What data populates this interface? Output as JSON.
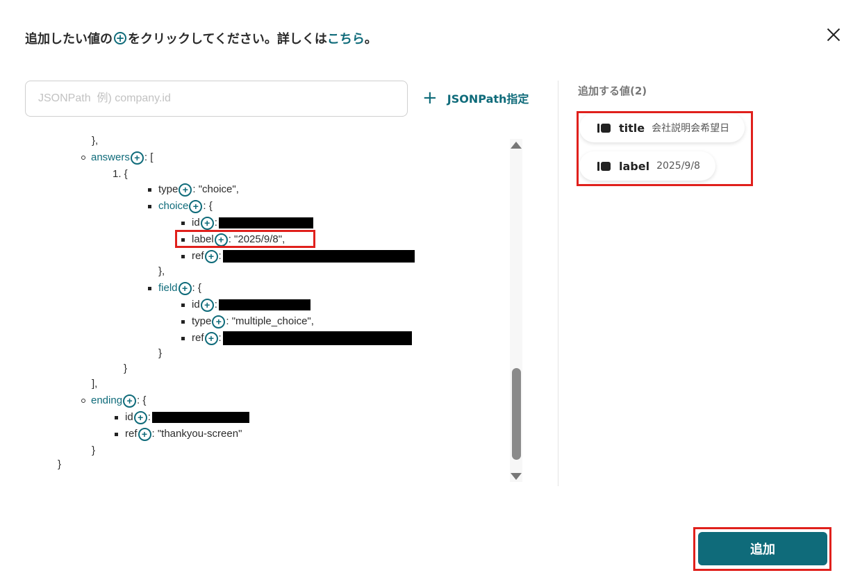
{
  "header": {
    "instruction_prefix": "追加したい値の",
    "instruction_suffix": "をクリックしてください。詳しくは",
    "help_link": "こちら",
    "end_mark": "。"
  },
  "search": {
    "placeholder": "JSONPath  例) company.id",
    "value": ""
  },
  "jsonpath_button": {
    "label": "JSONPath指定",
    "icon": "plus-icon"
  },
  "tree": {
    "l1": "},",
    "answers_key": "answers",
    "answers_tail": ": [",
    "item_index": "1. {",
    "type_key": "type",
    "type_val": ": \"choice\",",
    "choice_key": "choice",
    "choice_tail": ": {",
    "choice_id_key": "id",
    "choice_id_tail": ":",
    "choice_label_key": "label",
    "choice_label_val": ": \"2025/9/8\",",
    "choice_ref_key": "ref",
    "choice_ref_tail": ":",
    "choice_close": "},",
    "field_key": "field",
    "field_tail": ": {",
    "field_id_key": "id",
    "field_id_tail": ":",
    "field_type_key": "type",
    "field_type_val": ": \"multiple_choice\",",
    "field_ref_key": "ref",
    "field_ref_tail": ":",
    "field_close": "}",
    "item_close": "}",
    "answers_close": "],",
    "ending_key": "ending",
    "ending_tail": ": {",
    "ending_id_key": "id",
    "ending_id_tail": ":",
    "ending_ref_key": "ref",
    "ending_ref_val": ": \"thankyou-screen\"",
    "ending_close": "}",
    "root_close": "}"
  },
  "selected": {
    "heading": "追加する値(2)",
    "items": [
      {
        "key": "title",
        "value": "会社説明会希望日"
      },
      {
        "key": "label",
        "value": "2025/9/8"
      }
    ]
  },
  "add_button": {
    "label": "追加"
  },
  "colors": {
    "accent": "#0f6b7a",
    "highlight": "#e0201c"
  }
}
